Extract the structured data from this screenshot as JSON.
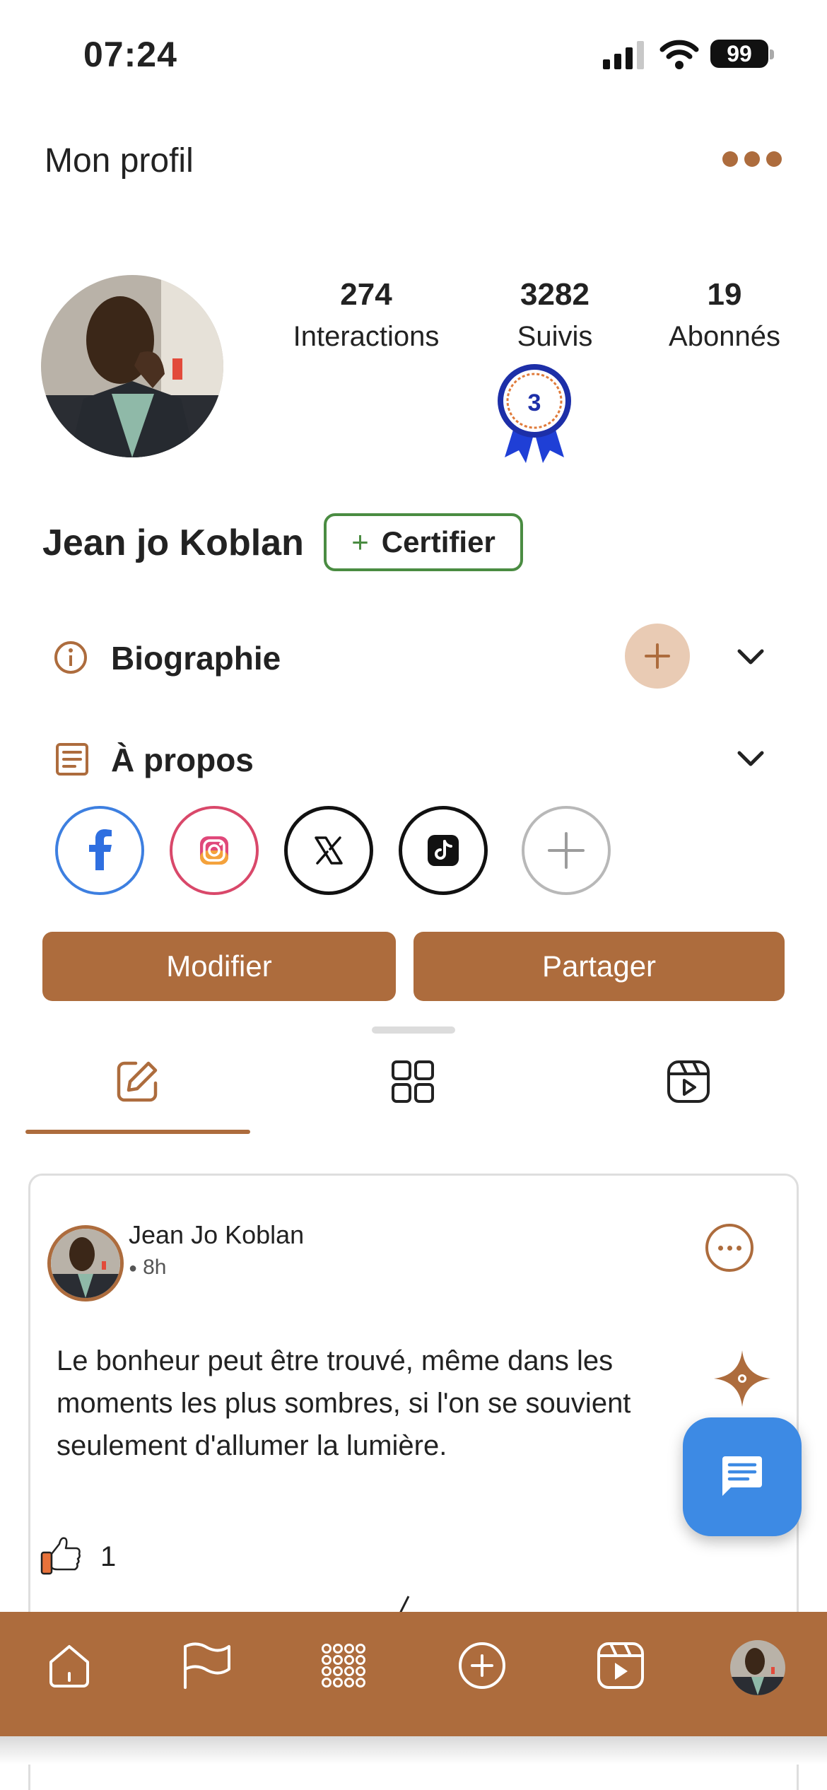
{
  "status_bar": {
    "time": "07:24",
    "battery": "99"
  },
  "header": {
    "title": "Mon profil",
    "more_icon": "more-horizontal-icon"
  },
  "profile": {
    "name": "Jean jo Koblan",
    "certify_label": "Certifier",
    "badge_level": "3",
    "stats": [
      {
        "value": "274",
        "label": "Interactions"
      },
      {
        "value": "3282",
        "label": "Suivis"
      },
      {
        "value": "19",
        "label": "Abonnés"
      }
    ]
  },
  "sections": {
    "bio": {
      "label": "Biographie",
      "icon": "info-icon"
    },
    "about": {
      "label": "À propos",
      "icon": "document-icon"
    }
  },
  "socials": [
    "facebook",
    "instagram",
    "x",
    "tiktok",
    "add"
  ],
  "actions": {
    "edit": "Modifier",
    "share": "Partager"
  },
  "tabs": [
    {
      "name": "posts",
      "icon": "edit-icon",
      "active": true
    },
    {
      "name": "grid",
      "icon": "grid-icon",
      "active": false
    },
    {
      "name": "reels",
      "icon": "reels-icon",
      "active": false
    }
  ],
  "post": {
    "author": "Jean Jo Koblan",
    "time": "8h",
    "text": "Le bonheur peut être trouvé, même dans les moments les plus sombres, si l'on se souvient seulement d'allumer la lumière.",
    "likes": "1"
  },
  "bottom_nav": [
    "home-icon",
    "flag-icon",
    "apps-icon",
    "add-circle-icon",
    "video-icon",
    "profile-avatar"
  ],
  "colors": {
    "accent": "#ad6c3d",
    "accent_light": "#e9cbb4",
    "green": "#4a8c42",
    "fab": "#3d8ae4"
  }
}
